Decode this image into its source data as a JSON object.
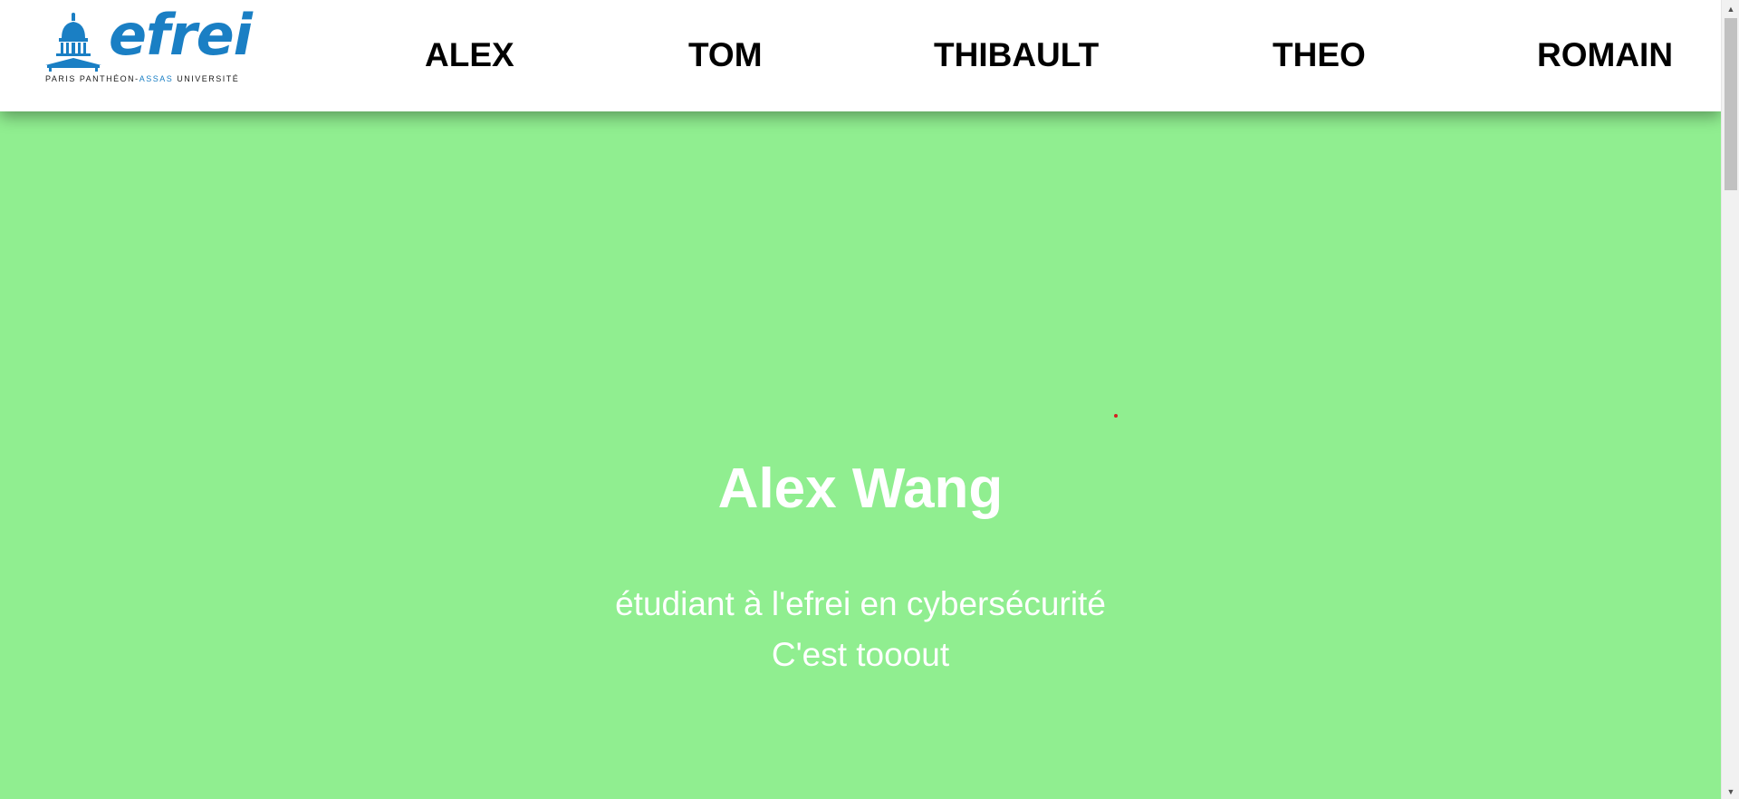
{
  "header": {
    "logo": {
      "wordmark": "efrei",
      "tagline_left": "PARIS PANTHÉON-",
      "tagline_mid": "ASSAS",
      "tagline_right": " UNIVERSITÉ"
    },
    "nav": [
      {
        "label": "ALEX"
      },
      {
        "label": "TOM"
      },
      {
        "label": "THIBAULT"
      },
      {
        "label": "THEO"
      },
      {
        "label": "ROMAIN"
      }
    ]
  },
  "hero": {
    "name": "Alex Wang",
    "line1": "étudiant à l'efrei en cybersécurité",
    "line2": "C'est tooout"
  },
  "colors": {
    "background": "#90ee90",
    "brand": "#1a7fc4",
    "header_bg": "#ffffff",
    "hero_text": "#ffffff"
  },
  "icons": {
    "logo_emblem": "pantheon-dome-icon",
    "scroll_up": "chevron-up-icon",
    "scroll_down": "chevron-down-icon"
  }
}
